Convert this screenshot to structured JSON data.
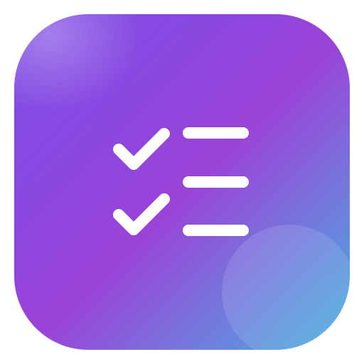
{
  "app_icon": {
    "icon": "checklist-icon",
    "gradient_colors": [
      "#7d4fe6",
      "#9b43d8",
      "#6f7fdd",
      "#3fb0dc"
    ],
    "glyph_color": "#ffffff",
    "items": [
      {
        "checked": true
      },
      {
        "checked": true
      },
      {
        "checked": false
      }
    ]
  }
}
